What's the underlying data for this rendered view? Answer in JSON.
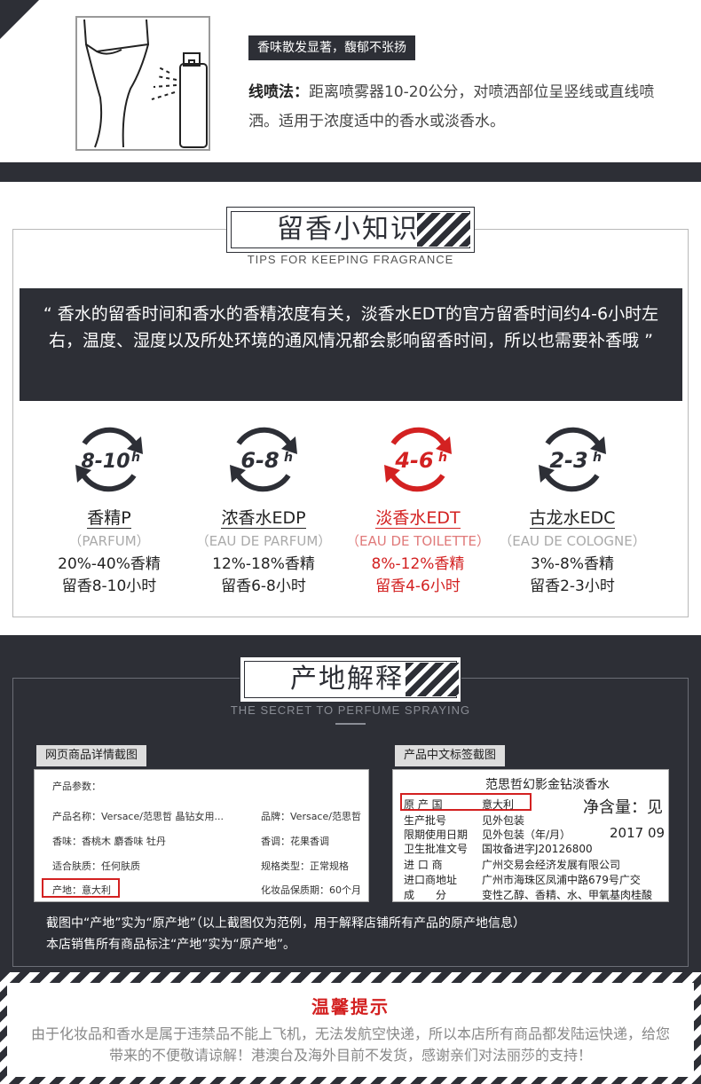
{
  "spray": {
    "tag": "香味散发显著，馥郁不张扬",
    "method_label": "线喷法：",
    "method_text": "距离喷雾器10-20公分，对喷洒部位呈竖线或直线喷洒。适用于浓度适中的香水或淡香水。"
  },
  "tips": {
    "title": "留香小知识",
    "subtitle": "TIPS FOR KEEPING FRAGRANCE",
    "quote": "“ 香水的留香时间和香水的香精浓度有关，淡香水EDT的官方留香时间约4-6小时左右，温度、湿度以及所处环境的通风情况都会影响留香时间，所以也需要补香哦 ”",
    "items": [
      {
        "hours": "8-10",
        "unit": "h",
        "name": "香精P",
        "en": "（PARFUM）",
        "concentration": "20%-40%香精",
        "duration": "留香8-10小时",
        "color": "#2d2f36"
      },
      {
        "hours": "6-8",
        "unit": "h",
        "name": "浓香水EDP",
        "en": "（EAU DE PARFUM）",
        "concentration": "12%-18%香精",
        "duration": "留香6-8小时",
        "color": "#2d2f36"
      },
      {
        "hours": "4-6",
        "unit": "h",
        "name": "淡香水EDT",
        "en": "（EAU DE TOILETTE）",
        "concentration": "8%-12%香精",
        "duration": "留香4-6小时",
        "color": "#d32121"
      },
      {
        "hours": "2-3",
        "unit": "h",
        "name": "古龙水EDC",
        "en": "（EAU DE COLOGNE）",
        "concentration": "3%-8%香精",
        "duration": "留香2-3小时",
        "color": "#2d2f36"
      }
    ]
  },
  "origin": {
    "title": "产地解释",
    "subtitle": "THE SECRET TO PERFUME SPRAYING",
    "web_tag": "网页商品详情截图",
    "label_tag": "产品中文标签截图",
    "web": {
      "heading": "产品参数：",
      "name": "产品名称：Versace/范思哲 晶钻女用...",
      "brand": "品牌：Versace/范思哲",
      "scent": "香味：香桃木 麝香味 牡丹",
      "note": "香调：花果香调",
      "skin": "适合肤质：任何肤质",
      "spec": "规格类型：正常规格",
      "origin": "产地：意大利",
      "shelf": "化妆品保质期：60个月"
    },
    "label": {
      "product": "范思哲幻影金钻淡香水",
      "net": "净含量：见",
      "origin_key": "原 产 国",
      "origin_val": "意大利",
      "batch_key": "生产批号",
      "batch_val": "见外包装",
      "expiry_key": "限期使用日期",
      "expiry_val": "见外包装（年/月）",
      "expiry_year": "2017 09",
      "license_key": "卫生批准文号",
      "license_val": "国妆备进字J20126800",
      "importer_key": "进 口 商",
      "importer_val": "广州交易会经济发展有限公司",
      "addr_key": "进口商地址",
      "addr_val": "广州市海珠区凤浦中路679号广交",
      "ingr_key": "成　　分",
      "ingr_val": "变性乙醇、香精、水、甲氧基肉桂酸"
    },
    "note_line1": "截图中“产地”实为“原产地”（以上截图仅为范例，用于解释店铺所有产品的原产地信息）",
    "note_line2": "本店销售所有商品标注“产地”实为“原产地”。"
  },
  "warning": {
    "title": "温馨提示",
    "text": "由于化妆品和香水是属于违禁品不能上飞机，无法发航空快递，所以本店所有商品都发陆运快递，给您带来的不便敬请谅解！港澳台及海外目前不发货，感谢亲们对法丽莎的支持！"
  }
}
